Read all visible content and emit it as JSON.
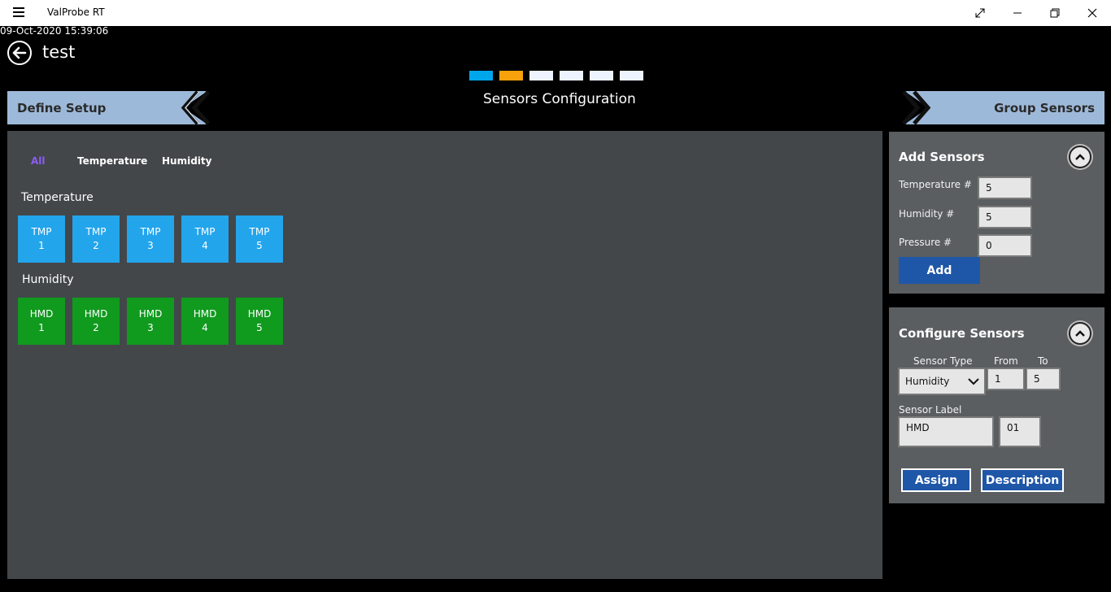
{
  "window": {
    "title": "ValProbe RT"
  },
  "status": {
    "timestamp": "09-Oct-2020 15:39:06"
  },
  "header": {
    "page_name": "test",
    "heading": "Sensors Configuration"
  },
  "steps": [
    {
      "color": "#00a6ec"
    },
    {
      "color": "#f7a20c"
    },
    {
      "color": "#eef4ff"
    },
    {
      "color": "#eef4ff"
    },
    {
      "color": "#eef4ff"
    },
    {
      "color": "#eef4ff"
    }
  ],
  "nav": {
    "prev_label": "Define Setup",
    "next_label": "Group Sensors"
  },
  "filters": {
    "all": "All",
    "temperature": "Temperature",
    "humidity": "Humidity",
    "active_color": "#8b5cf6"
  },
  "sections": {
    "temperature": {
      "title": "Temperature",
      "tiles": [
        {
          "type": "TMP",
          "num": "1"
        },
        {
          "type": "TMP",
          "num": "2"
        },
        {
          "type": "TMP",
          "num": "3"
        },
        {
          "type": "TMP",
          "num": "4"
        },
        {
          "type": "TMP",
          "num": "5"
        }
      ]
    },
    "humidity": {
      "title": "Humidity",
      "tiles": [
        {
          "type": "HMD",
          "num": "1"
        },
        {
          "type": "HMD",
          "num": "2"
        },
        {
          "type": "HMD",
          "num": "3"
        },
        {
          "type": "HMD",
          "num": "4"
        },
        {
          "type": "HMD",
          "num": "5"
        }
      ]
    }
  },
  "add_sensors": {
    "title": "Add Sensors",
    "temperature_label": "Temperature #",
    "temperature_value": "5",
    "humidity_label": "Humidity #",
    "humidity_value": "5",
    "pressure_label": "Pressure #",
    "pressure_value": "0",
    "add_button": "Add"
  },
  "configure_sensors": {
    "title": "Configure Sensors",
    "sensor_type_label": "Sensor Type",
    "sensor_type_value": "Humidity",
    "from_label": "From",
    "from_value": "1",
    "to_label": "To",
    "to_value": "5",
    "sensor_label_label": "Sensor Label",
    "label_prefix": "HMD",
    "label_start": "01",
    "assign_button": "Assign",
    "description_button": "Description"
  }
}
